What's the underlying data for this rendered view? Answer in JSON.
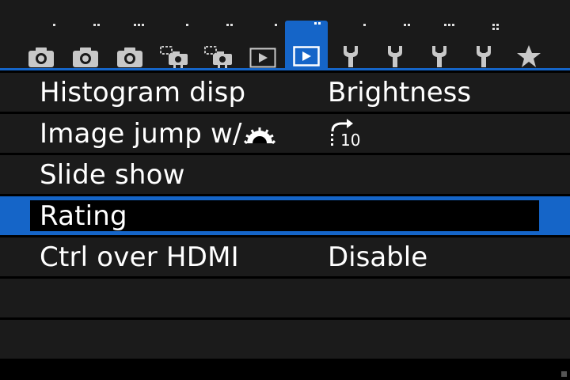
{
  "tabs": [
    {
      "icon": "camera-icon",
      "dots": 1
    },
    {
      "icon": "camera-icon",
      "dots": 2
    },
    {
      "icon": "camera-icon",
      "dots": 3
    },
    {
      "icon": "camera-live-view-icon",
      "dots": 1
    },
    {
      "icon": "camera-live-view-icon",
      "dots": 2
    },
    {
      "icon": "playback-icon",
      "dots": 1
    },
    {
      "icon": "playback-icon",
      "dots": 2,
      "active": true
    },
    {
      "icon": "wrench-icon",
      "dots": 1
    },
    {
      "icon": "wrench-icon",
      "dots": 2
    },
    {
      "icon": "wrench-icon",
      "dots": 3
    },
    {
      "icon": "wrench-icon",
      "dots": 4
    },
    {
      "icon": "star-icon",
      "dots": 0
    }
  ],
  "menu": {
    "items": [
      {
        "label": "Histogram disp",
        "value": "Brightness"
      },
      {
        "label": "Image jump w/",
        "value": "10",
        "label_icon": "main-dial-icon",
        "value_icon": "jump-10-icon"
      },
      {
        "label": "Slide show",
        "value": ""
      },
      {
        "label": "Rating",
        "value": "",
        "selected": true
      },
      {
        "label": "Ctrl over HDMI",
        "value": "Disable"
      }
    ]
  },
  "colors": {
    "accent": "#1565c8",
    "row_bg": "#1b1b1b",
    "background": "#000000"
  }
}
